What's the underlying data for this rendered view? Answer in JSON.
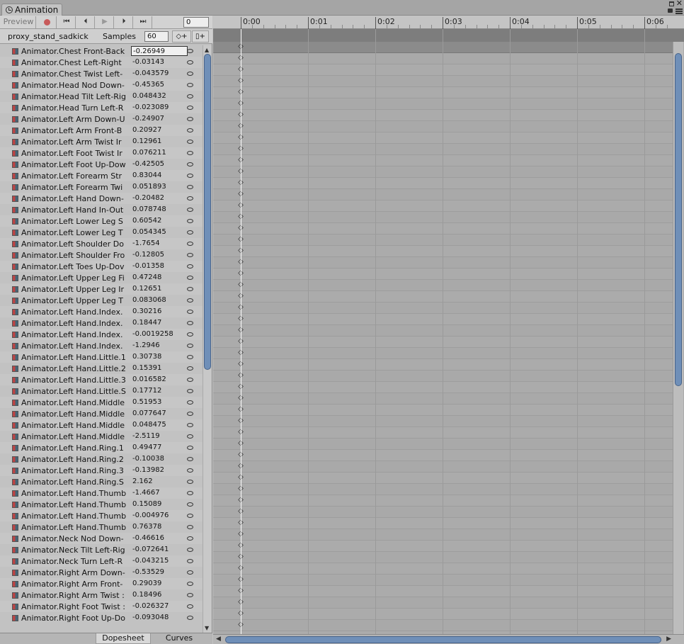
{
  "window": {
    "tab_title": "Animation"
  },
  "toolbar": {
    "preview_label": "Preview",
    "first_glyph": "⏮",
    "prev_glyph": "⏴",
    "play_glyph": "▶",
    "next_glyph": "⏵",
    "last_glyph": "⏭",
    "frame_value": "0",
    "clip_name": "proxy_stand_sadkick",
    "samples_label": "Samples",
    "samples_value": "60",
    "add_keyframe_glyph": "◇+",
    "add_event_glyph": "▯+"
  },
  "properties": [
    {
      "name": "Animator.Chest Front-Back",
      "value": "-0.26949"
    },
    {
      "name": "Animator.Chest Left-Right",
      "value": "-0.03143"
    },
    {
      "name": "Animator.Chest Twist Left-",
      "value": "-0.043579"
    },
    {
      "name": "Animator.Head Nod Down-",
      "value": "-0.45365"
    },
    {
      "name": "Animator.Head Tilt Left-Rig",
      "value": "0.048432"
    },
    {
      "name": "Animator.Head Turn Left-R",
      "value": "-0.023089"
    },
    {
      "name": "Animator.Left Arm Down-U",
      "value": "-0.24907"
    },
    {
      "name": "Animator.Left Arm Front-B",
      "value": "0.20927"
    },
    {
      "name": "Animator.Left Arm Twist Ir",
      "value": "0.12961"
    },
    {
      "name": "Animator.Left Foot Twist Ir",
      "value": "0.076211"
    },
    {
      "name": "Animator.Left Foot Up-Dow",
      "value": "-0.42505"
    },
    {
      "name": "Animator.Left Forearm Str",
      "value": "0.83044"
    },
    {
      "name": "Animator.Left Forearm Twi",
      "value": "0.051893"
    },
    {
      "name": "Animator.Left Hand Down-",
      "value": "-0.20482"
    },
    {
      "name": "Animator.Left Hand In-Out",
      "value": "0.078748"
    },
    {
      "name": "Animator.Left Lower Leg S",
      "value": "0.60542"
    },
    {
      "name": "Animator.Left Lower Leg T",
      "value": "0.054345"
    },
    {
      "name": "Animator.Left Shoulder Do",
      "value": "-1.7654"
    },
    {
      "name": "Animator.Left Shoulder Fro",
      "value": "-0.12805"
    },
    {
      "name": "Animator.Left Toes Up-Dov",
      "value": "-0.01358"
    },
    {
      "name": "Animator.Left Upper Leg Fi",
      "value": "0.47248"
    },
    {
      "name": "Animator.Left Upper Leg Ir",
      "value": "0.12651"
    },
    {
      "name": "Animator.Left Upper Leg T",
      "value": "0.083068"
    },
    {
      "name": "Animator.Left Hand.Index.",
      "value": "0.30216"
    },
    {
      "name": "Animator.Left Hand.Index.",
      "value": "0.18447"
    },
    {
      "name": "Animator.Left Hand.Index.",
      "value": "-0.0019258"
    },
    {
      "name": "Animator.Left Hand.Index.",
      "value": "-1.2946"
    },
    {
      "name": "Animator.Left Hand.Little.1",
      "value": "0.30738"
    },
    {
      "name": "Animator.Left Hand.Little.2",
      "value": "0.15391"
    },
    {
      "name": "Animator.Left Hand.Little.3",
      "value": "0.016582"
    },
    {
      "name": "Animator.Left Hand.Little.S",
      "value": "0.17712"
    },
    {
      "name": "Animator.Left Hand.Middle",
      "value": "0.51953"
    },
    {
      "name": "Animator.Left Hand.Middle",
      "value": "0.077647"
    },
    {
      "name": "Animator.Left Hand.Middle",
      "value": "0.048475"
    },
    {
      "name": "Animator.Left Hand.Middle",
      "value": "-2.5119"
    },
    {
      "name": "Animator.Left Hand.Ring.1",
      "value": "0.49477"
    },
    {
      "name": "Animator.Left Hand.Ring.2",
      "value": "-0.10038"
    },
    {
      "name": "Animator.Left Hand.Ring.3",
      "value": "-0.13982"
    },
    {
      "name": "Animator.Left Hand.Ring.S",
      "value": "2.162"
    },
    {
      "name": "Animator.Left Hand.Thumb",
      "value": "-1.4667"
    },
    {
      "name": "Animator.Left Hand.Thumb",
      "value": "0.15089"
    },
    {
      "name": "Animator.Left Hand.Thumb",
      "value": "-0.004976"
    },
    {
      "name": "Animator.Left Hand.Thumb",
      "value": "0.76378"
    },
    {
      "name": "Animator.Neck Nod Down-",
      "value": "-0.46616"
    },
    {
      "name": "Animator.Neck Tilt Left-Rig",
      "value": "-0.072641"
    },
    {
      "name": "Animator.Neck Turn Left-R",
      "value": "-0.043215"
    },
    {
      "name": "Animator.Right Arm Down-",
      "value": "-0.53529"
    },
    {
      "name": "Animator.Right Arm Front-",
      "value": "0.29039"
    },
    {
      "name": "Animator.Right Arm Twist :",
      "value": "0.18496"
    },
    {
      "name": "Animator.Right Foot Twist :",
      "value": "-0.026327"
    },
    {
      "name": "Animator.Right Foot Up-Do",
      "value": "-0.093048"
    }
  ],
  "ruler": {
    "labels": [
      "0:00",
      "0:01",
      "0:02",
      "0:03",
      "0:04",
      "0:05",
      "0:06"
    ]
  },
  "bottom_tabs": {
    "dopesheet": "Dopesheet",
    "curves": "Curves"
  },
  "colors": {
    "scroll_thumb": "#6f8fb8",
    "record": "#c75a5a",
    "playhead": "#ffffff"
  }
}
